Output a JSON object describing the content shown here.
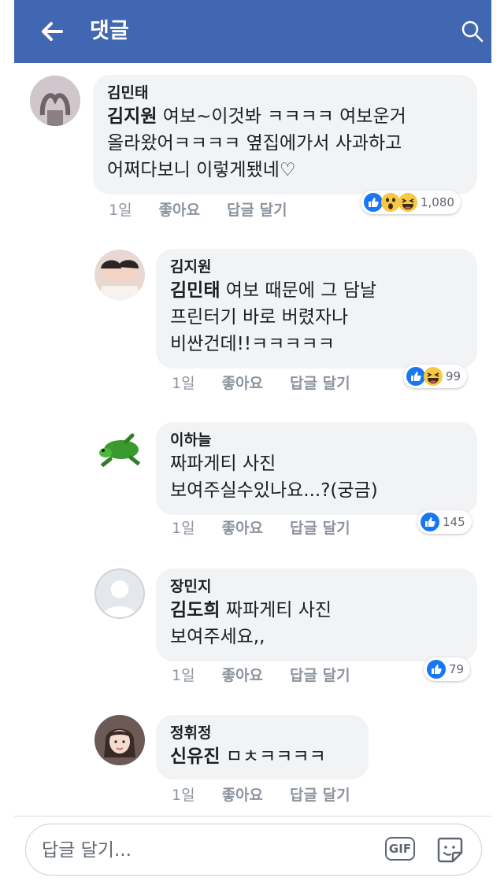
{
  "header": {
    "title": "댓글",
    "bg_color": "#4267b2"
  },
  "comments": [
    {
      "author": "김민태",
      "mention": "김지원",
      "lines": [
        "여보~이것봐 ㅋㅋㅋㅋ 여보운거",
        "올라왔어ㅋㅋㅋㅋ 옆집에가서 사과하고",
        "어쩌다보니 이렇게됐네♡"
      ],
      "time": "1일",
      "like": "좋아요",
      "reply": "답글 달기",
      "reactions": [
        "like",
        "wow",
        "haha"
      ],
      "reaction_count": "1,080",
      "avatar": "hand-heart-photo"
    },
    {
      "author": "김지원",
      "mention": "김민태",
      "lines": [
        "여보 때문에 그 담날",
        "프린터기 바로 버렸자나",
        "비싼건데!!ㅋㅋㅋㅋㅋ"
      ],
      "time": "1일",
      "like": "좋아요",
      "reply": "답글 달기",
      "reactions": [
        "like",
        "haha"
      ],
      "reaction_count": "99",
      "avatar": "couple-photo"
    },
    {
      "author": "이하늘",
      "mention": "",
      "lines": [
        "짜파게티 사진",
        "보여주실수있나요...?(궁금)"
      ],
      "time": "1일",
      "like": "좋아요",
      "reply": "답글 달기",
      "reactions": [
        "like"
      ],
      "reaction_count": "145",
      "avatar": "green-frog-toy"
    },
    {
      "author": "장민지",
      "mention": "김도희",
      "lines": [
        "짜파게티 사진",
        "보여주세요,,"
      ],
      "time": "1일",
      "like": "좋아요",
      "reply": "답글 달기",
      "reactions": [
        "like"
      ],
      "reaction_count": "79",
      "avatar": "default-profile"
    },
    {
      "author": "정휘정",
      "mention": "신유진",
      "lines": [
        "ㅁㅊㅋㅋㅋㅋ"
      ],
      "time": "1일",
      "like": "좋아요",
      "reply": "답글 달기",
      "reactions": [],
      "reaction_count": "",
      "avatar": "girl-photo"
    }
  ],
  "composer": {
    "placeholder": "답글 달기...",
    "gif_label": "GIF"
  },
  "colors": {
    "like_blue": "#1877f2",
    "emoji_yellow": "#f7c843",
    "bubble_gray": "#f2f3f5",
    "meta_gray": "#8d949e"
  }
}
